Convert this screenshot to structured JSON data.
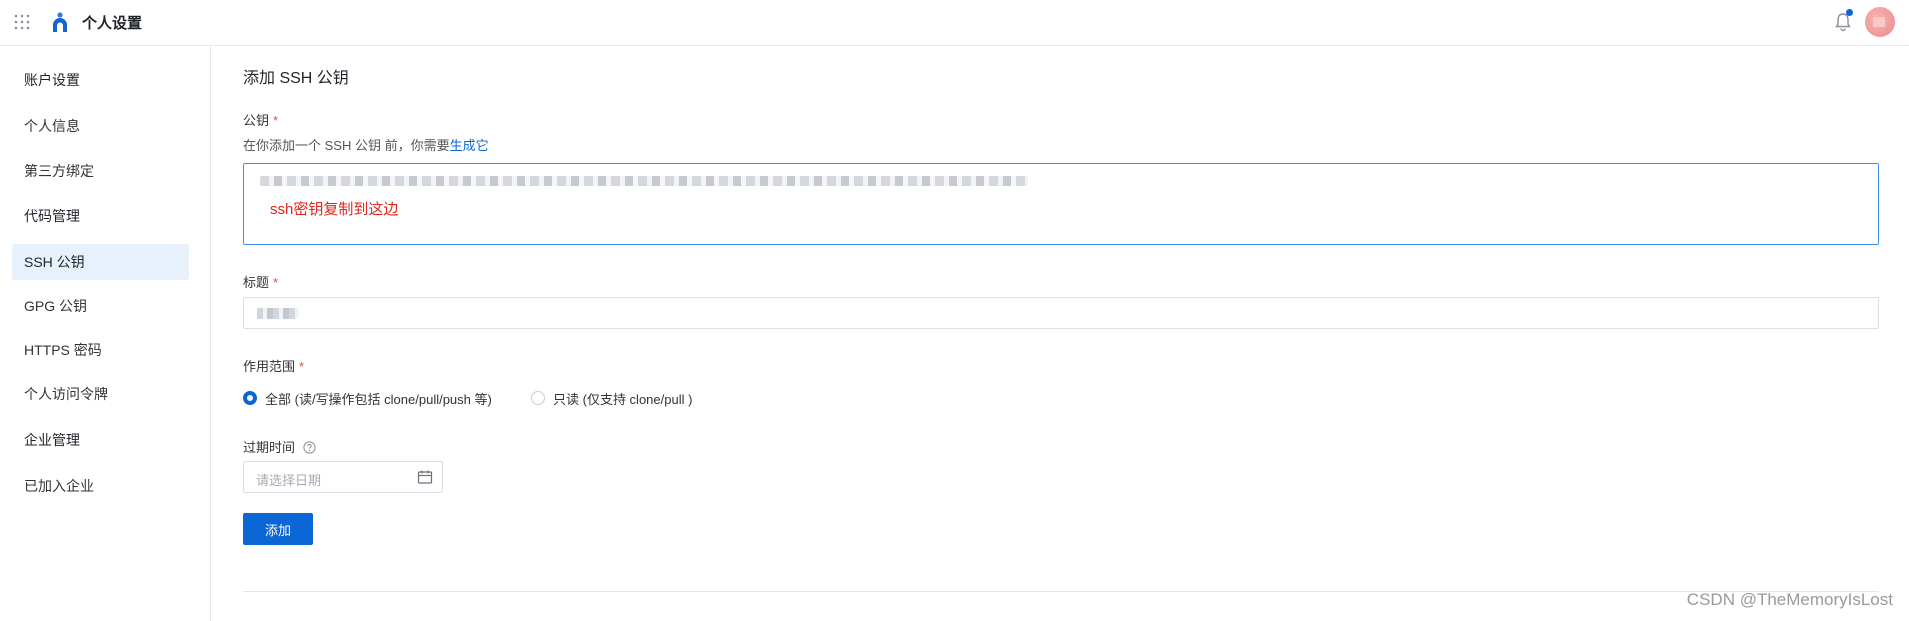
{
  "header": {
    "apps_icon": "grid-icon",
    "logo_icon": "logo-icon",
    "title": "个人设置",
    "bell_icon": "bell-icon",
    "accent": "#0b66d6"
  },
  "sidebar": {
    "items": [
      {
        "label": "账户设置",
        "type": "group"
      },
      {
        "label": "个人信息",
        "type": "item"
      },
      {
        "label": "第三方绑定",
        "type": "item"
      },
      {
        "label": "代码管理",
        "type": "group"
      },
      {
        "label": "SSH 公钥",
        "type": "item",
        "active": true
      },
      {
        "label": "GPG 公钥",
        "type": "item"
      },
      {
        "label": "HTTPS 密码",
        "type": "item"
      },
      {
        "label": "个人访问令牌",
        "type": "item"
      },
      {
        "label": "企业管理",
        "type": "group"
      },
      {
        "label": "已加入企业",
        "type": "item"
      }
    ]
  },
  "main": {
    "page_title": "添加 SSH 公钥",
    "public_key": {
      "label": "公钥",
      "required_mark": "*",
      "hint_prefix": "在你添加一个 SSH 公钥 前，你需要",
      "hint_link": "生成它",
      "annotation": "ssh密钥复制到这边",
      "annotation_color": "#e0261b"
    },
    "key_title": {
      "label": "标题",
      "required_mark": "*"
    },
    "scope": {
      "label": "作用范围",
      "required_mark": "*",
      "options": [
        {
          "label": "全部 (读/写操作包括 clone/pull/push 等)",
          "checked": true
        },
        {
          "label": "只读 (仅支持 clone/pull )",
          "checked": false
        }
      ]
    },
    "expiry": {
      "label": "过期时间",
      "help_icon": "help-circle-icon",
      "placeholder": "请选择日期",
      "calendar_icon": "calendar-icon"
    },
    "submit_label": "添加"
  },
  "watermark": "CSDN @TheMemoryIsLost"
}
